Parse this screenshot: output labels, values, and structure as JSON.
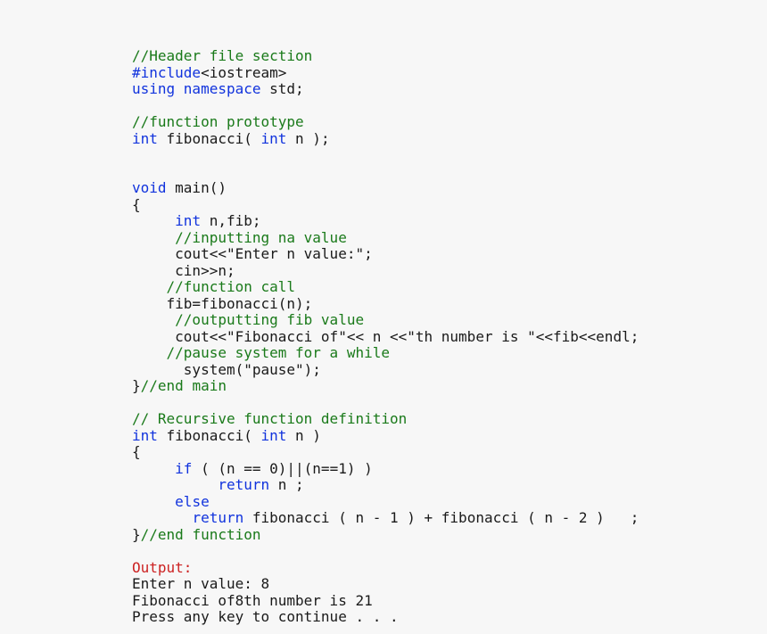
{
  "document": {
    "kind": "code-listing",
    "language": "C++",
    "background_color": "#f7f7f7",
    "colors": {
      "comment": "#1a7a1a",
      "keyword": "#1133dd",
      "plain": "#1a1a1a",
      "output_label": "#cc2222"
    }
  },
  "lines": [
    {
      "id": "l1",
      "segments": [
        {
          "text": "//Header file section",
          "style": "comment"
        }
      ]
    },
    {
      "id": "l2",
      "segments": [
        {
          "text": "#include",
          "style": "keyword"
        },
        {
          "text": "<iostream>",
          "style": "plain"
        }
      ]
    },
    {
      "id": "l3",
      "segments": [
        {
          "text": "using namespace",
          "style": "keyword"
        },
        {
          "text": " std;",
          "style": "plain"
        }
      ]
    },
    {
      "id": "l4",
      "segments": [
        {
          "text": "",
          "style": "plain"
        }
      ]
    },
    {
      "id": "l5",
      "segments": [
        {
          "text": "//function prototype",
          "style": "comment"
        }
      ]
    },
    {
      "id": "l6",
      "segments": [
        {
          "text": "int",
          "style": "keyword"
        },
        {
          "text": " fibonacci( ",
          "style": "plain"
        },
        {
          "text": "int",
          "style": "keyword"
        },
        {
          "text": " n );",
          "style": "plain"
        }
      ]
    },
    {
      "id": "l7",
      "segments": [
        {
          "text": "",
          "style": "plain"
        }
      ]
    },
    {
      "id": "l8",
      "segments": [
        {
          "text": "",
          "style": "plain"
        }
      ]
    },
    {
      "id": "l9",
      "segments": [
        {
          "text": "void",
          "style": "keyword"
        },
        {
          "text": " main()",
          "style": "plain"
        }
      ]
    },
    {
      "id": "l10",
      "segments": [
        {
          "text": "{",
          "style": "plain"
        }
      ]
    },
    {
      "id": "l11",
      "segments": [
        {
          "text": "     ",
          "style": "plain"
        },
        {
          "text": "int",
          "style": "keyword"
        },
        {
          "text": " n,fib;",
          "style": "plain"
        }
      ]
    },
    {
      "id": "l12",
      "segments": [
        {
          "text": "     //inputting na value",
          "style": "comment"
        }
      ]
    },
    {
      "id": "l13",
      "segments": [
        {
          "text": "     cout<<\"Enter n value:\";",
          "style": "plain"
        }
      ]
    },
    {
      "id": "l14",
      "segments": [
        {
          "text": "     cin>>n;",
          "style": "plain"
        }
      ]
    },
    {
      "id": "l15",
      "segments": [
        {
          "text": "    //function call",
          "style": "comment"
        }
      ]
    },
    {
      "id": "l16",
      "segments": [
        {
          "text": "    fib=fibonacci(n);",
          "style": "plain"
        }
      ]
    },
    {
      "id": "l17",
      "segments": [
        {
          "text": "     //outputting fib value",
          "style": "comment"
        }
      ]
    },
    {
      "id": "l18",
      "segments": [
        {
          "text": "     cout<<\"Fibonacci of\"<< n <<\"th number is \"<<fib<<endl;",
          "style": "plain"
        }
      ]
    },
    {
      "id": "l19",
      "segments": [
        {
          "text": "    //pause system for a while",
          "style": "comment"
        }
      ]
    },
    {
      "id": "l20",
      "segments": [
        {
          "text": "      system(\"pause\");",
          "style": "plain"
        }
      ]
    },
    {
      "id": "l21",
      "segments": [
        {
          "text": "}",
          "style": "plain"
        },
        {
          "text": "//end main",
          "style": "comment"
        }
      ]
    },
    {
      "id": "l22",
      "segments": [
        {
          "text": "",
          "style": "plain"
        }
      ]
    },
    {
      "id": "l23",
      "segments": [
        {
          "text": "// Recursive function definition",
          "style": "comment"
        }
      ]
    },
    {
      "id": "l24",
      "segments": [
        {
          "text": "int",
          "style": "keyword"
        },
        {
          "text": " fibonacci( ",
          "style": "plain"
        },
        {
          "text": "int",
          "style": "keyword"
        },
        {
          "text": " n )",
          "style": "plain"
        }
      ]
    },
    {
      "id": "l25",
      "segments": [
        {
          "text": "{",
          "style": "plain"
        }
      ]
    },
    {
      "id": "l26",
      "segments": [
        {
          "text": "     ",
          "style": "plain"
        },
        {
          "text": "if",
          "style": "keyword"
        },
        {
          "text": " ( (n == 0)||(n==1) )",
          "style": "plain"
        }
      ]
    },
    {
      "id": "l27",
      "segments": [
        {
          "text": "          ",
          "style": "plain"
        },
        {
          "text": "return",
          "style": "keyword"
        },
        {
          "text": " n ;",
          "style": "plain"
        }
      ]
    },
    {
      "id": "l28",
      "segments": [
        {
          "text": "     ",
          "style": "plain"
        },
        {
          "text": "else",
          "style": "keyword"
        }
      ]
    },
    {
      "id": "l29",
      "segments": [
        {
          "text": "       ",
          "style": "plain"
        },
        {
          "text": "return",
          "style": "keyword"
        },
        {
          "text": " fibonacci ( n - 1 ) + fibonacci ( n - 2 )   ;",
          "style": "plain"
        }
      ]
    },
    {
      "id": "l30",
      "segments": [
        {
          "text": "}",
          "style": "plain"
        },
        {
          "text": "//end function",
          "style": "comment"
        }
      ]
    },
    {
      "id": "l31",
      "segments": [
        {
          "text": "",
          "style": "plain"
        }
      ]
    },
    {
      "id": "l32",
      "segments": [
        {
          "text": "Output:",
          "style": "output-label"
        }
      ]
    },
    {
      "id": "l33",
      "segments": [
        {
          "text": "Enter n value: 8",
          "style": "plain"
        }
      ]
    },
    {
      "id": "l34",
      "segments": [
        {
          "text": "Fibonacci of8th number is 21",
          "style": "plain"
        }
      ]
    },
    {
      "id": "l35",
      "segments": [
        {
          "text": "Press any key to continue . . .",
          "style": "plain"
        }
      ]
    }
  ]
}
